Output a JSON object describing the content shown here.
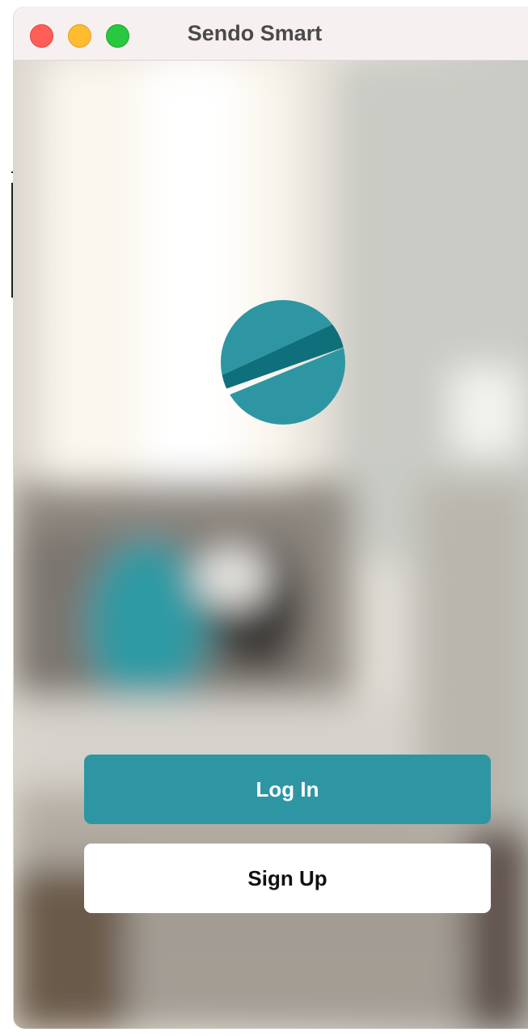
{
  "window": {
    "title": "Sendo Smart",
    "controls": [
      "close",
      "minimize",
      "maximize"
    ]
  },
  "logo": {
    "icon": "sendo-logo-icon",
    "color": "#2e96a3"
  },
  "actions": {
    "login_label": "Log In",
    "signup_label": "Sign Up"
  },
  "colors": {
    "accent": "#2e96a3",
    "titlebar": "#f7f0f1"
  }
}
